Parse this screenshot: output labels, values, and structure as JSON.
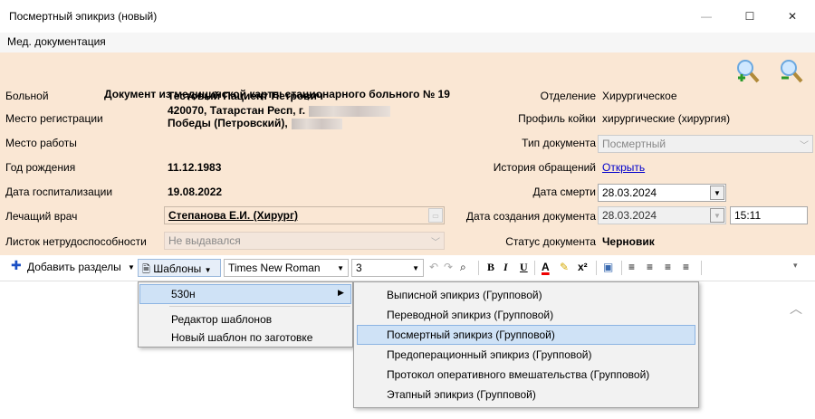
{
  "window": {
    "title": "Посмертный эпикриз (новый)",
    "minimize_glyph": "—",
    "maximize_glyph": "☐",
    "close_glyph": "✕"
  },
  "menu": {
    "med_docs": "Мед. документация"
  },
  "header": {
    "doc_title": "Документ из медицинской карты стационарного больного  №  19",
    "patient_label": "Больной",
    "patient_value": "Тестовый Пациент Петрович",
    "registration_label": "Место регистрации",
    "registration_line1": "420070, Татарстан Респ, г.",
    "registration_line2": "Победы (Петровский),",
    "work_label": "Место работы",
    "birth_label": "Год рождения",
    "birth_value": "11.12.1983",
    "hosp_label": "Дата госпитализации",
    "hosp_value": "19.08.2022",
    "doctor_label": "Лечащий врач",
    "doctor_value": "Степанова Е.И. (Хирург)",
    "sick_label": "Листок нетрудоспособности",
    "sick_value": "Не выдавался",
    "dept_label": "Отделение",
    "dept_value": "Хирургическое",
    "bed_label": "Профиль койки",
    "bed_value": "хирургические (хирургия)",
    "doctype_label": "Тип документа",
    "doctype_value": "Посмертный",
    "history_label": "История обращений",
    "history_link": "Открыть",
    "death_label": "Дата смерти",
    "death_value": "28.03.2024",
    "created_label": "Дата создания документа",
    "created_date": "28.03.2024",
    "created_time": "15:11",
    "status_label": "Статус документа",
    "status_value": "Черновик"
  },
  "toolbar": {
    "add_sections": "Добавить разделы",
    "templates": "Шаблоны",
    "font": "Times New Roman",
    "size": "3",
    "bold": "B",
    "italic": "I",
    "underline": "U",
    "font_color": "A",
    "superscript": "x²"
  },
  "templates_menu": {
    "items": [
      "530н",
      "Редактор шаблонов",
      "Новый шаблон по заготовке"
    ]
  },
  "submenu": {
    "items": [
      "Выписной эпикриз (Групповой)",
      "Переводной эпикриз (Групповой)",
      "Посмертный эпикриз (Групповой)",
      "Предоперационный эпикриз (Групповой)",
      "Протокол оперативного вмешательства (Групповой)",
      "Этапный эпикриз (Групповой)"
    ]
  },
  "colors": {
    "header_bg": "#fae7d4",
    "highlight": "#cfe2f6",
    "link": "#0000cc",
    "add_icon": "#1a4fc4"
  }
}
